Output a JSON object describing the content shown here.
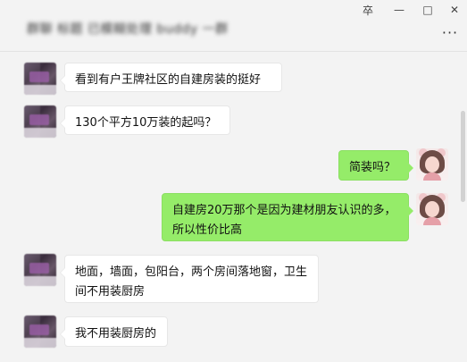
{
  "window": {
    "title": "群聊 标题 已模糊处理 buddy 一群",
    "pin_icon": "卒",
    "minimize_icon": "—",
    "maximize_icon": "□",
    "close_icon": "✕",
    "more_icon": "···"
  },
  "messages": [
    {
      "side": "left",
      "avatar": "blurred-avatar",
      "text": "看到有户王牌社区的自建房装的挺好"
    },
    {
      "side": "left",
      "avatar": "blurred-avatar",
      "text": "130个平方10万装的起吗？"
    },
    {
      "side": "right",
      "avatar": "cat-ear-girl-avatar",
      "text": "简装吗？"
    },
    {
      "side": "right",
      "avatar": "cat-ear-girl-avatar",
      "text": "自建房20万那个是因为建材朋友认识的多，所以性价比高"
    },
    {
      "side": "left",
      "avatar": "blurred-avatar",
      "text": "地面，墙面，包阳台，两个房间落地窗，卫生间不用装厨房"
    },
    {
      "side": "left",
      "avatar": "blurred-avatar",
      "text": "我不用装厨房的"
    }
  ],
  "colors": {
    "background": "#f3f3f3",
    "incoming_bubble": "#ffffff",
    "outgoing_bubble": "#95ec69"
  }
}
